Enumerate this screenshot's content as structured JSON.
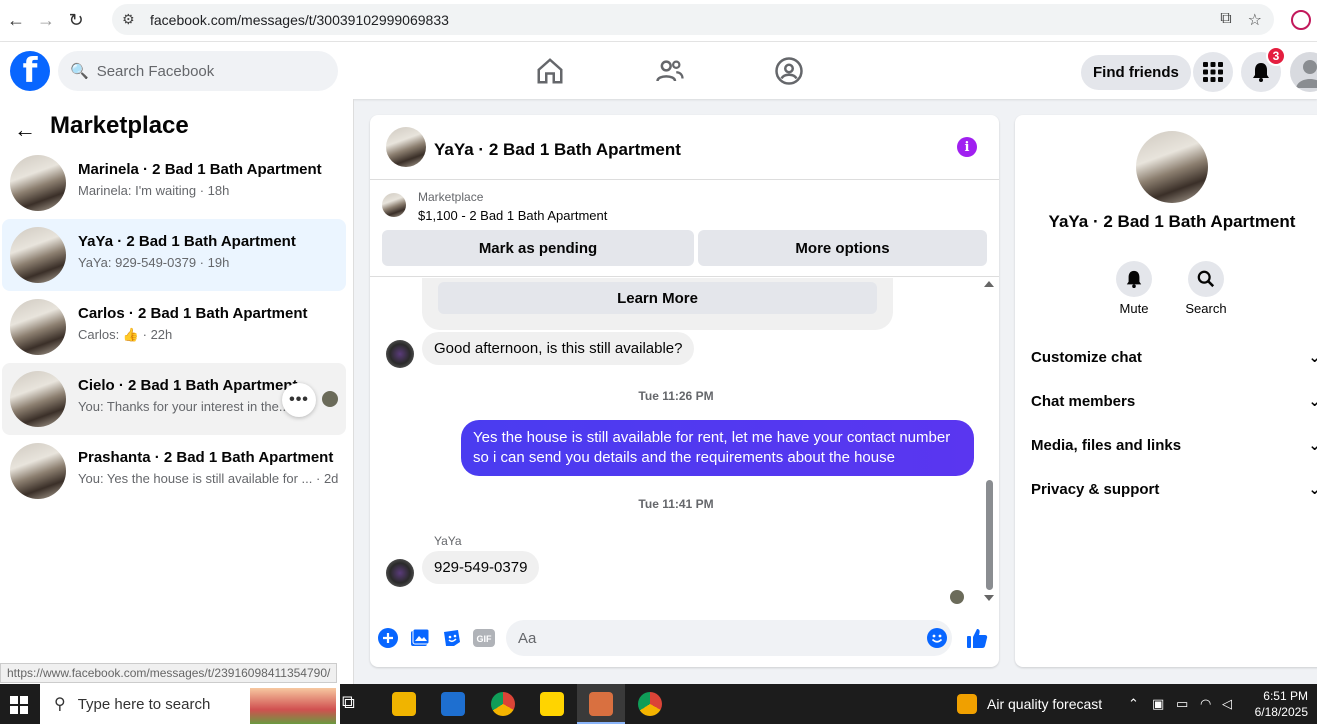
{
  "browser": {
    "url": "facebook.com/messages/t/30039102999069833",
    "status_url": "https://www.facebook.com/messages/t/23916098411354790/"
  },
  "header": {
    "search_placeholder": "Search Facebook",
    "find_friends": "Find friends",
    "notification_count": "3"
  },
  "sidebar": {
    "title": "Marketplace",
    "conversations": [
      {
        "name": "Marinela · 2 Bad 1 Bath Apartment",
        "preview": "Marinela: I'm waiting · 18h"
      },
      {
        "name": "YaYa · 2 Bad 1 Bath Apartment",
        "preview": "YaYa: 929-549-0379 · 19h"
      },
      {
        "name": "Carlos · 2 Bad 1 Bath Apartment",
        "preview": "Carlos:",
        "preview_time": "· 22h"
      },
      {
        "name": "Cielo · 2 Bad 1 Bath Apartment",
        "preview": "You: Thanks for your interest in the..."
      },
      {
        "name": "Prashanta · 2 Bad 1 Bath Apartment",
        "preview": "You: Yes the house is still available for ... · 2d"
      }
    ]
  },
  "chat": {
    "title": "YaYa · 2 Bad 1 Bath Apartment",
    "listing_label": "Marketplace",
    "listing_price": "$1,100 - 2 Bad 1 Bath Apartment",
    "mark_pending": "Mark as pending",
    "more_options": "More options",
    "learn_more": "Learn More",
    "msg1": "Good afternoon, is this still available?",
    "time1": "Tue 11:26 PM",
    "msg2_line1": "Yes the house is still available for rent, let me have your contact number",
    "msg2_line2": "so i can send you details and the requirements about the house",
    "time2": "Tue 11:41 PM",
    "sender": "YaYa",
    "msg3": "929-549-0379",
    "input_placeholder": "Aa",
    "gif_label": "GIF"
  },
  "right_panel": {
    "title": "YaYa · 2 Bad 1 Bath Apartment",
    "mute": "Mute",
    "search": "Search",
    "rows": [
      "Customize chat",
      "Chat members",
      "Media, files and links",
      "Privacy & support"
    ]
  },
  "taskbar": {
    "search_placeholder": "Type here to search",
    "weather": "Air quality forecast",
    "time": "6:51 PM",
    "date": "6/18/2025"
  },
  "colors": {
    "fb_blue": "#0866ff",
    "outgoing_bubble": "#5a36f0",
    "selected_conv": "#ebf5ff"
  }
}
